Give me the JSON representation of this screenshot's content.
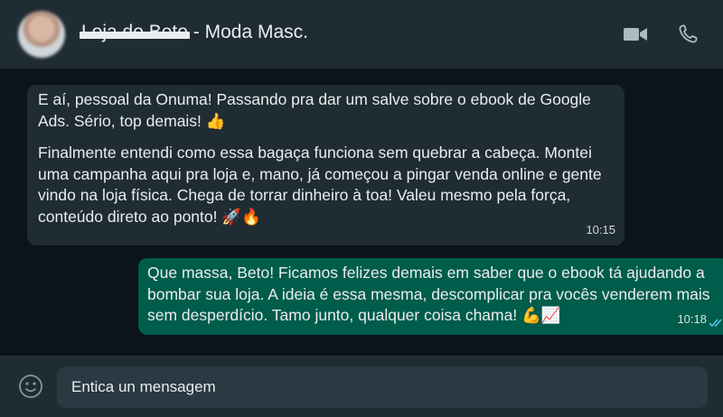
{
  "header": {
    "contact_redacted": "Loja do Beto",
    "contact_suffix": " - Moda Masc.",
    "video_icon": "video-camera-icon",
    "call_icon": "phone-icon"
  },
  "messages": {
    "incoming": {
      "paragraph1": "E aí, pessoal da Onuma! Passando pra dar um salve sobre o ebook de Google Ads. Sério, top demais! 👍",
      "paragraph2": "Finalmente entendi como essa bagaça funciona sem quebrar a cabeça. Montei uma campanha aqui pra loja e, mano, já começou a pingar venda online e gente vindo na loja física. Chega de torrar dinheiro à toa! Valeu mesmo pela força, conteúdo direto ao ponto! 🚀🔥",
      "time": "10:15"
    },
    "outgoing": {
      "text": "Que massa, Beto! Ficamos felizes demais em saber que o ebook tá ajudando a bombar sua loja. A ideia é essa mesma, descomplicar pra vocês venderem mais sem desperdício. Tamo junto, qualquer coisa chama! 💪📈",
      "time": "10:18",
      "status_icon": "double-check-icon"
    }
  },
  "composer": {
    "placeholder": "Entica un mensagem",
    "emoji_icon": "smiley-icon"
  },
  "colors": {
    "header_bg": "#202c33",
    "chat_bg": "#0b141a",
    "incoming_bubble": "#202c33",
    "outgoing_bubble": "#005c4b",
    "read_tick": "#53bdeb"
  }
}
